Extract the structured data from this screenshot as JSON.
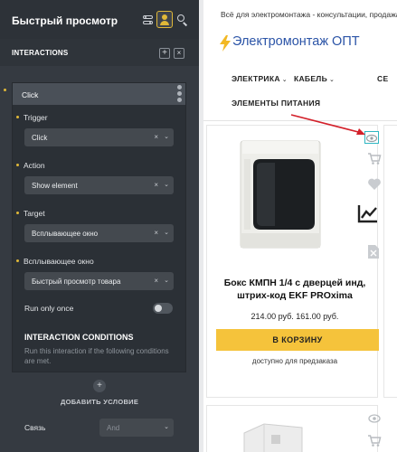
{
  "panel": {
    "title": "Быстрый просмотр",
    "interactions_label": "INTERACTIONS",
    "add_symbol": "+",
    "close_symbol": "×",
    "card": {
      "label": "Click",
      "fields": {
        "trigger": {
          "label": "Trigger",
          "value": "Click"
        },
        "action": {
          "label": "Action",
          "value": "Show element"
        },
        "target": {
          "label": "Target",
          "value": "Всплывающее окно"
        },
        "popup": {
          "label": "Всплывающее окно",
          "value": "Быстрый просмотр товара"
        }
      },
      "clear_symbol": "×",
      "chevron_symbol": "⌄"
    },
    "run_only_once": {
      "label": "Run only once",
      "enabled": false
    },
    "conditions": {
      "title": "INTERACTION CONDITIONS",
      "description": "Run this interaction if the following conditions are met.",
      "add_label": "ДОБАВИТЬ УСЛОВИЕ",
      "add_symbol": "+"
    },
    "relation": {
      "label": "Связь",
      "value": "And"
    },
    "accent_color": "#e0b838"
  },
  "store": {
    "tagline": "Всё для электромонтажа - консультации, продажа",
    "logo": "Электромонтаж ОПТ",
    "nav": {
      "elektrika": "ЭЛЕКТРИКА",
      "kabel": "КАБЕЛЬ",
      "se": "СЕ",
      "power": "ЭЛЕМЕНТЫ ПИТАНИЯ"
    },
    "product": {
      "title_line1": "Бокс КМПН 1/4 с дверцей инд,",
      "title_line2": "штрих-код EKF PROxima",
      "price": "214.00 руб. 161.00 руб.",
      "cart_button": "В КОРЗИНУ",
      "availability": "доступно для предзаказа"
    },
    "icons": [
      "eye-icon",
      "cart-icon",
      "heart-icon",
      "chart-icon",
      "file-icon"
    ],
    "brand_color": "#2b54a7",
    "button_color": "#f5c33b"
  }
}
